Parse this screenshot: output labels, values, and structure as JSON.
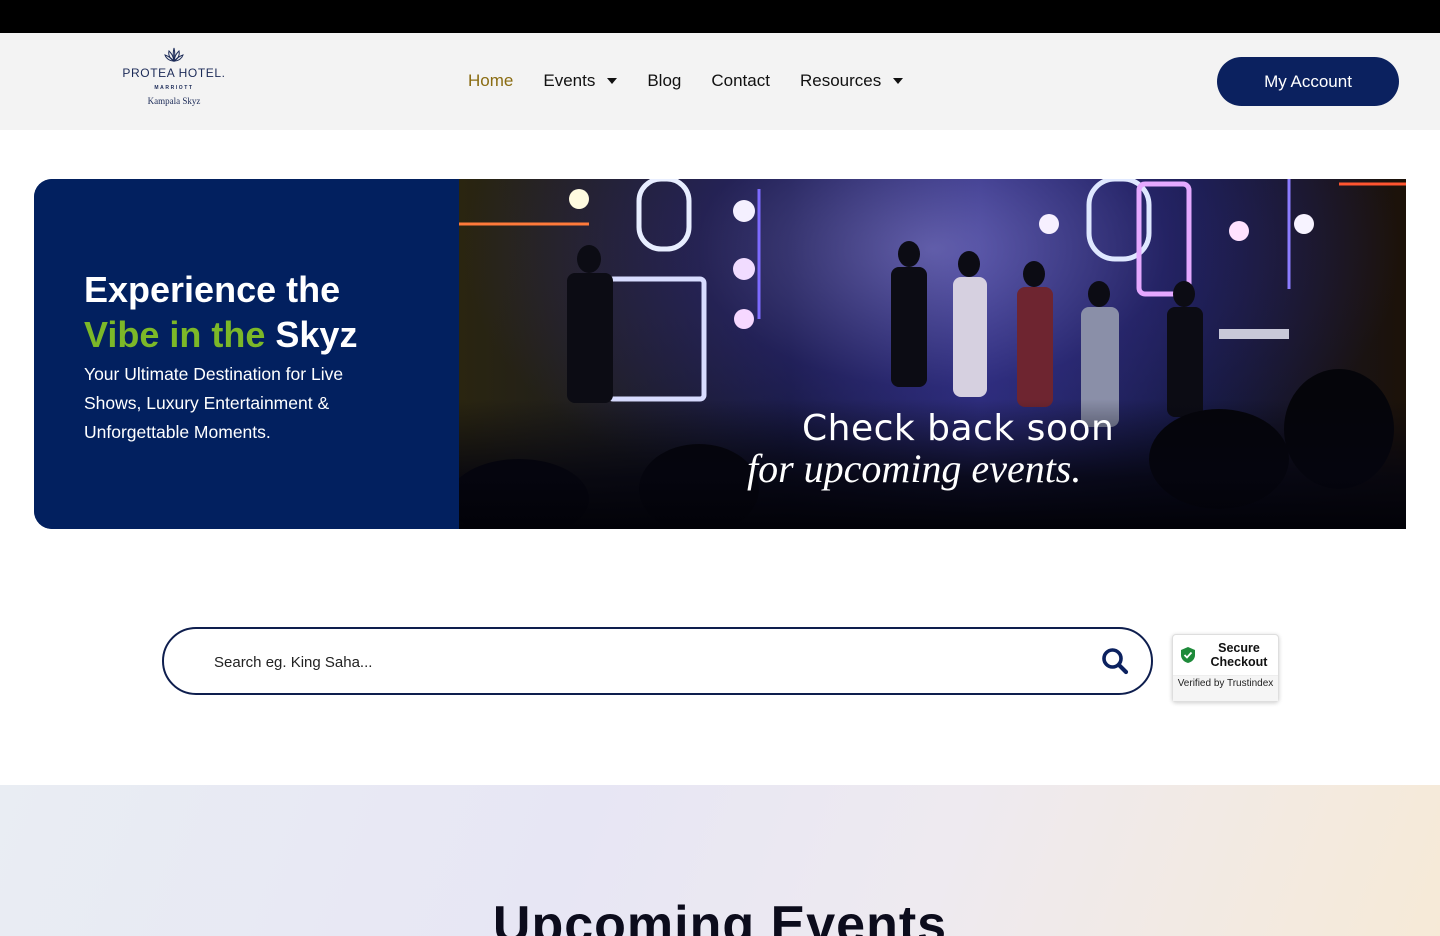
{
  "header": {
    "logo": {
      "brand": "PROTEA HOTEL.",
      "sub": "MARRIOTT",
      "location": "Kampala Skyz"
    },
    "nav": [
      {
        "label": "Home",
        "active": true,
        "dropdown": false
      },
      {
        "label": "Events",
        "active": false,
        "dropdown": true
      },
      {
        "label": "Blog",
        "active": false,
        "dropdown": false
      },
      {
        "label": "Contact",
        "active": false,
        "dropdown": false
      },
      {
        "label": "Resources",
        "active": false,
        "dropdown": true
      }
    ],
    "account_label": "My Account"
  },
  "hero": {
    "title_line1": "Experience the",
    "title_line2_green": "Vibe in the",
    "title_line2_white": "Skyz",
    "subtitle": "Your Ultimate Destination for Live Shows, Luxury Entertainment & Unforgettable Moments.",
    "image_text_line1": "Check back soon",
    "image_text_line2": "for upcoming events."
  },
  "search": {
    "placeholder": "Search eg. King Saha...",
    "value": ""
  },
  "badge": {
    "title": "Secure Checkout",
    "footer": "Verified by Trustindex"
  },
  "upcoming": {
    "title": "Upcoming Events"
  },
  "colors": {
    "navy": "#0b215f",
    "green": "#7cb828",
    "active_nav": "#8a6c12"
  }
}
